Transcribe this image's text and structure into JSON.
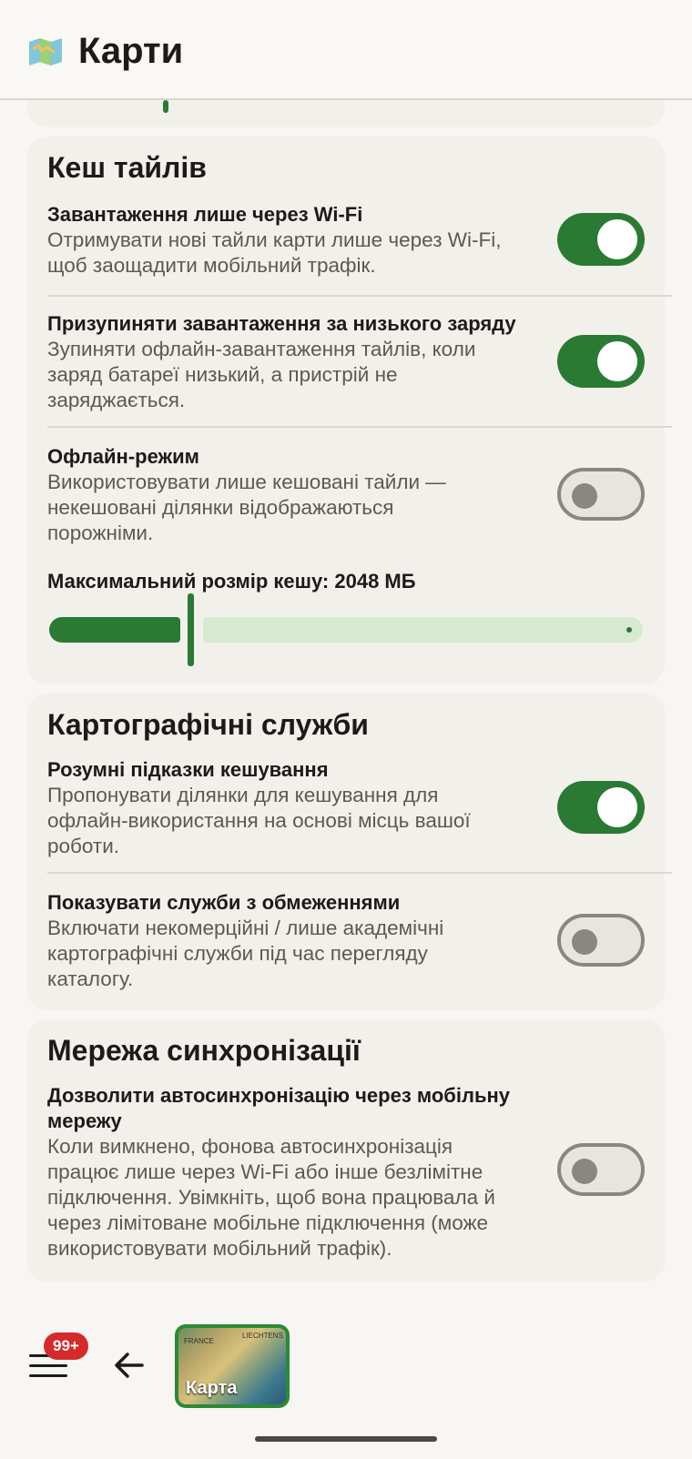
{
  "app": {
    "title": "Карти",
    "icon": "map-app-icon"
  },
  "tile_cache": {
    "title": "Кеш тайлів",
    "wifi_only": {
      "title": "Завантаження лише через Wi-Fi",
      "desc_line1": "Отримувати нові тайли карти лише через Wi-Fi,",
      "desc_line2": "щоб заощадити мобільний трафік.",
      "enabled": true
    },
    "pause_low_battery": {
      "title": "Призупиняти завантаження за низького заряду",
      "desc_line1": "Зупиняти офлайн-завантаження тайлів, коли",
      "desc_line2": "заряд батареї низький, а пристрій не",
      "desc_line3": "заряджається.",
      "enabled": true
    },
    "offline_mode": {
      "title": "Офлайн-режим",
      "desc_line1": "Використовувати лише кешовані тайли —",
      "desc_line2": "некешовані ділянки відображаються",
      "desc_line3": "порожніми.",
      "enabled": false
    },
    "max_cache": {
      "label": "Максимальний розмір кешу: 2048 МБ",
      "value_fraction": 0.24
    }
  },
  "map_services": {
    "title": "Картографічні служби",
    "smart_hints": {
      "title": "Розумні підказки кешування",
      "desc_line1": "Пропонувати ділянки для кешування для",
      "desc_line2": "офлайн-використання на основі місць вашої",
      "desc_line3": "роботи.",
      "enabled": true
    },
    "restricted": {
      "title": "Показувати служби з обмеженнями",
      "desc_line1": "Включати некомерційні / лише академічні",
      "desc_line2": "картографічні служби під час перегляду",
      "desc_line3": "каталогу.",
      "enabled": false
    }
  },
  "sync_network": {
    "title": "Мережа синхронізації",
    "mobile_autosync": {
      "title_line1": "Дозволити автосинхронізацію через мобільну",
      "title_line2": "мережу",
      "desc_line1": "Коли вимкнено, фонова автосинхронізація",
      "desc_line2": "працює лише через Wi-Fi або інше безлімітне",
      "desc_line3": "підключення. Увімкніть, щоб вона працювала й",
      "desc_line4": "через лімітоване мобільне підключення (може",
      "desc_line5": "використовувати мобільний трафік).",
      "enabled": false
    }
  },
  "bottom_bar": {
    "badge": "99+",
    "map_label": "Карта",
    "map_tiny_1": "FRANCE",
    "map_tiny_2": "LIECHTENS"
  },
  "colors": {
    "accent": "#2a7a33",
    "badge": "#d42a2a"
  }
}
